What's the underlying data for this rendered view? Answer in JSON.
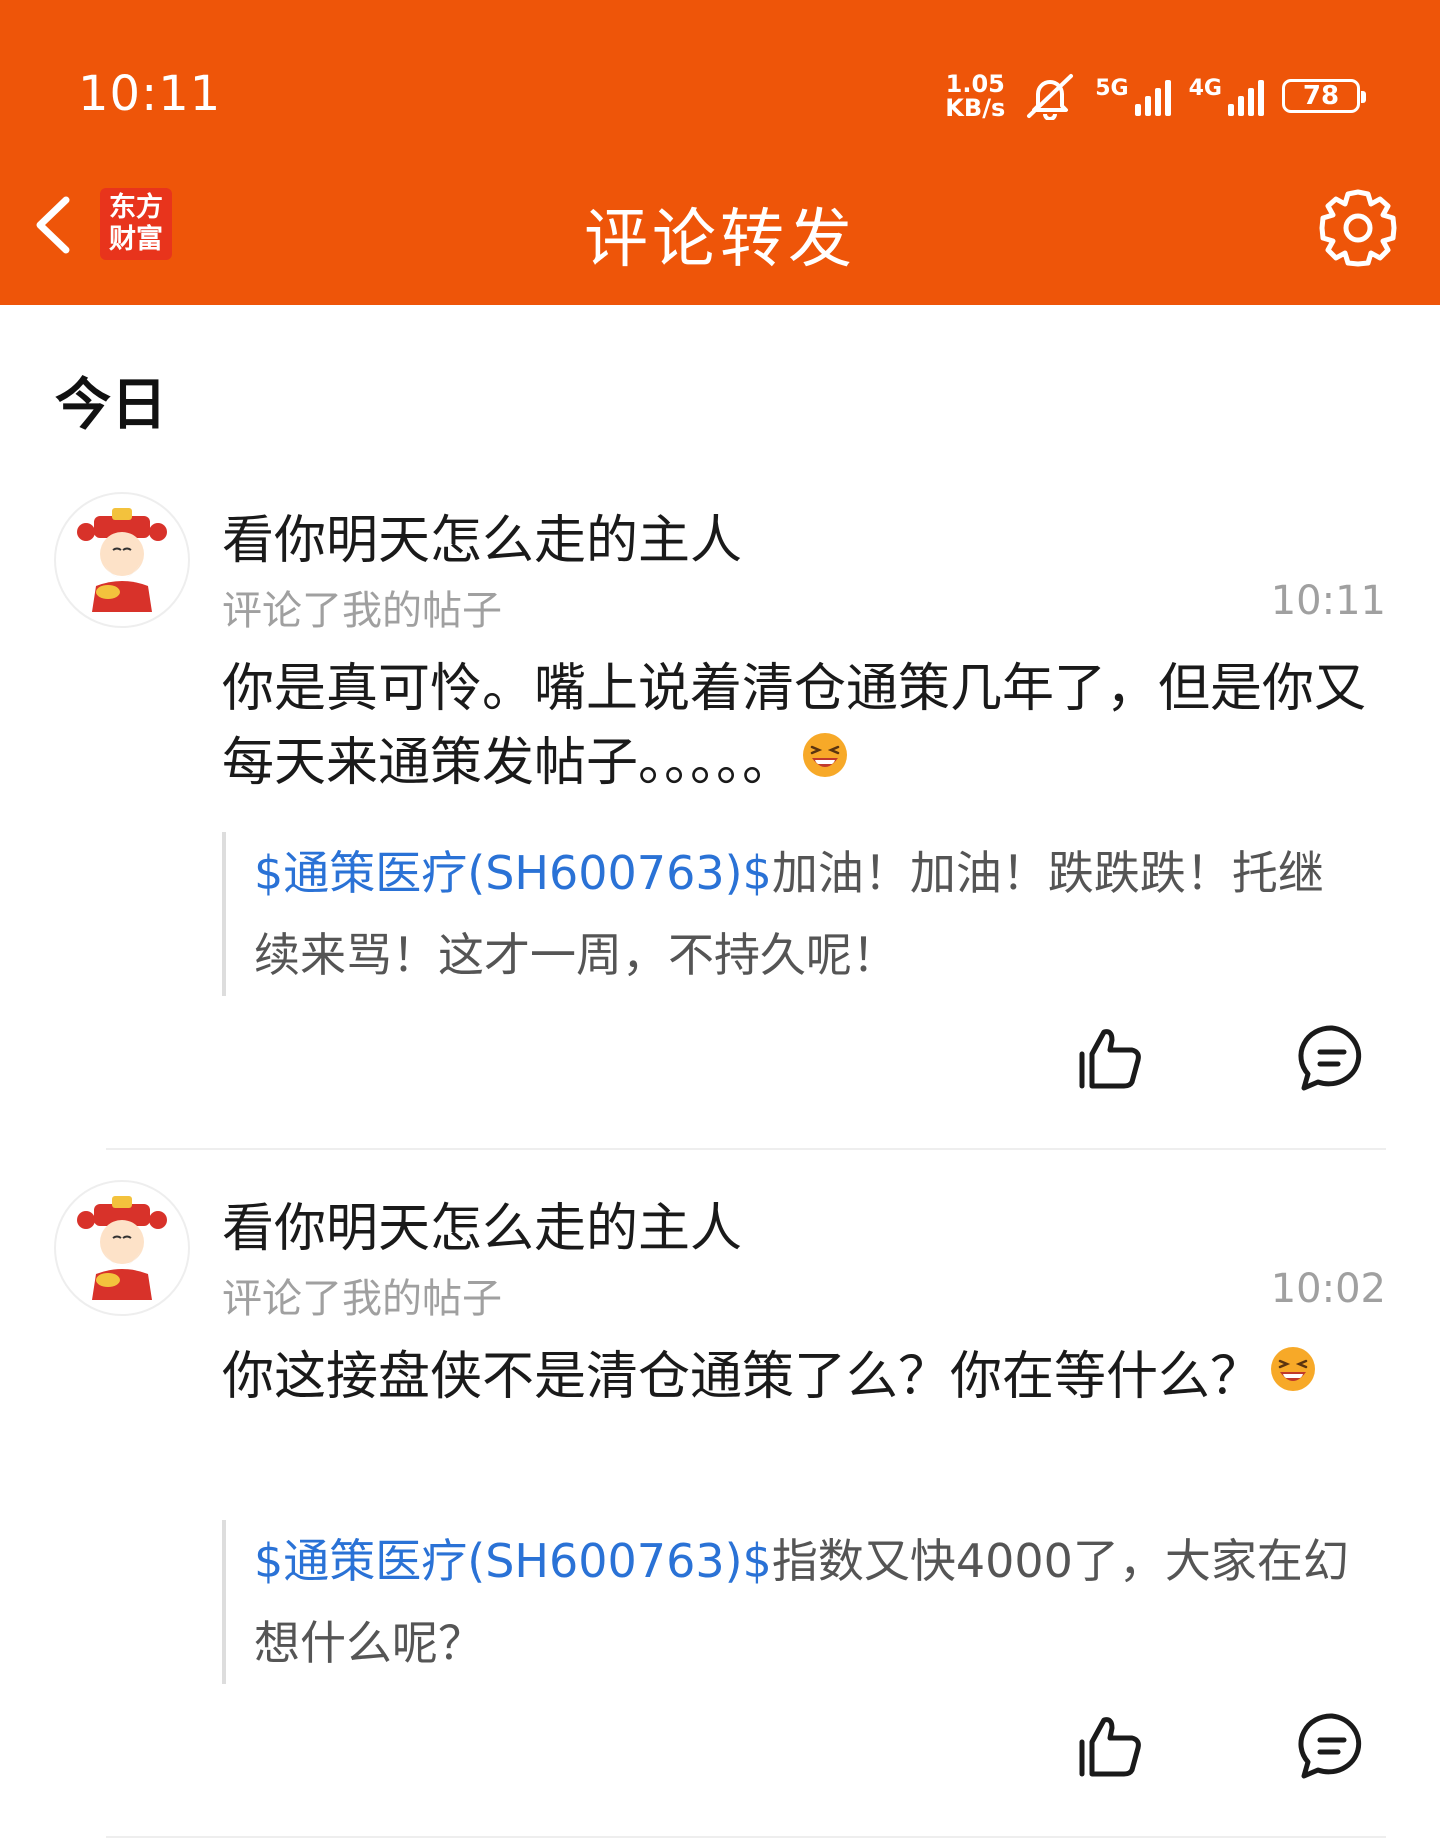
{
  "status_bar": {
    "time": "10:11",
    "net_speed_value": "1.05",
    "net_speed_unit": "KB/s",
    "sim1_label": "5G",
    "sim2_label": "4G",
    "battery": "78"
  },
  "nav": {
    "title": "评论转发",
    "logo_line1": "东方",
    "logo_line2": "财富"
  },
  "section": {
    "heading": "今日"
  },
  "notifications": [
    {
      "username": "看你明天怎么走的主人",
      "action": "评论了我的帖子",
      "time": "10:11",
      "comment": "你是真可怜。嘴上说着清仓通策几年了，但是你又每天来通策发帖子。。。。。",
      "quote_link": "$通策医疗(SH600763)$",
      "quote_text": "加油！加油！跌跌跌！托继续来骂！这才一周，不持久呢！"
    },
    {
      "username": "看你明天怎么走的主人",
      "action": "评论了我的帖子",
      "time": "10:02",
      "comment": "你这接盘侠不是清仓通策了么？你在等什么？",
      "quote_link": "$通策医疗(SH600763)$",
      "quote_text": "指数又快4000了，大家在幻想什么呢？"
    }
  ],
  "icons": {
    "back": "chevron-left-icon",
    "settings": "gear-icon",
    "like": "thumbs-up-icon",
    "reply": "comment-bubble-icon",
    "emoji": "laughing-emoji-icon",
    "mute": "bell-off-icon"
  },
  "colors": {
    "header": "#ee5509",
    "link": "#2a72d6",
    "logo": "#e8341c"
  }
}
